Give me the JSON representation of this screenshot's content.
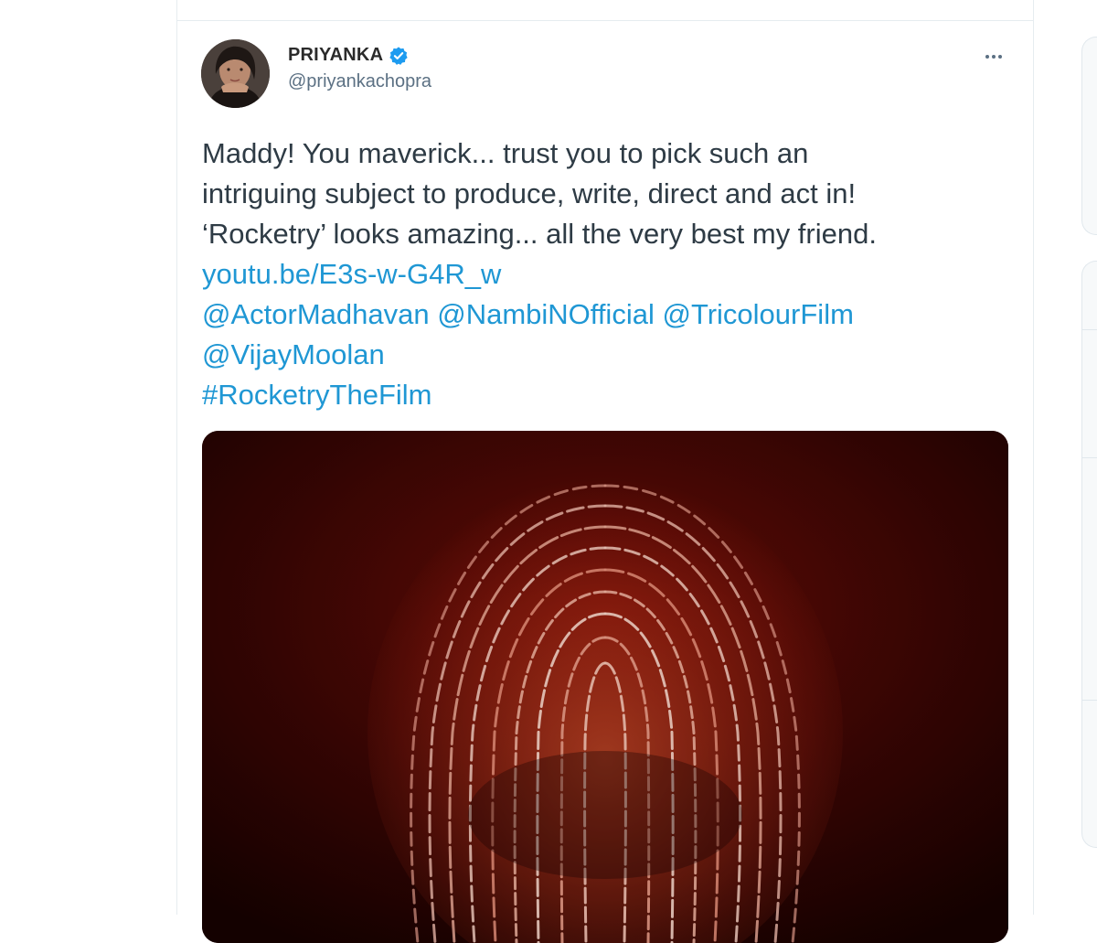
{
  "tweet": {
    "display_name": "PRIYANKA",
    "handle": "@priyankachopra",
    "text_lines": [
      "Maddy! You maverick... trust you to pick such an",
      "intriguing subject to produce, write, direct and act in!",
      "‘Rocketry’ looks amazing... all the very best my friend."
    ],
    "link": "youtu.be/E3s-w-G4R_w",
    "mentions": [
      "@ActorMadhavan",
      "@NambiNOfficial",
      "@TricolourFilm",
      "@VijayMoolan"
    ],
    "hashtag": "#RocketryTheFilm",
    "media_description": "Fingerprint artwork poster"
  },
  "icons": {
    "verified": "verified-badge-icon",
    "more": "more-options-icon"
  },
  "colors": {
    "link": "#1f97d4",
    "verified": "#1d9bf0",
    "text": "#2e3b45",
    "muted": "#5b7083",
    "border": "#e6ecf0",
    "media_bg": "#2a0503"
  }
}
